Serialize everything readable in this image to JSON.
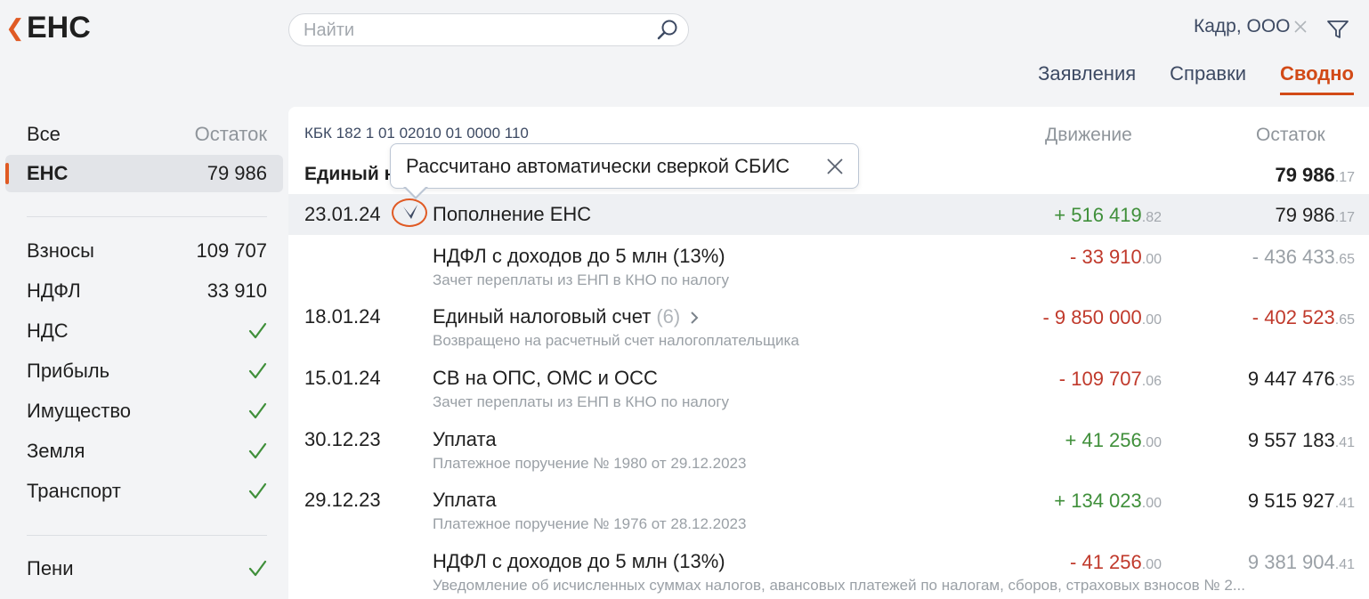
{
  "header": {
    "back_icon": "chevron-left-icon",
    "title": "ЕНС",
    "search": {
      "placeholder": "Найти",
      "value": "",
      "icon": "search-icon"
    },
    "org": "Кадр, ООО",
    "org_clear_icon": "close-icon",
    "filter_icon": "filter-icon"
  },
  "tabs": [
    {
      "label": "Заявления",
      "active": false
    },
    {
      "label": "Справки",
      "active": false
    },
    {
      "label": "Сводно",
      "active": true
    }
  ],
  "sidebar": {
    "all_label": "Все",
    "balance_header": "Остаток",
    "selected": {
      "label": "ЕНС",
      "value": "79 986"
    },
    "taxes": [
      {
        "label": "Взносы",
        "value": "109 707"
      },
      {
        "label": "НДФЛ",
        "value": "33 910"
      },
      {
        "label": "НДС",
        "status": "ok"
      },
      {
        "label": "Прибыль",
        "status": "ok"
      },
      {
        "label": "Имущество",
        "status": "ok"
      },
      {
        "label": "Земля",
        "status": "ok"
      },
      {
        "label": "Транспорт",
        "status": "ok"
      }
    ],
    "penalties": {
      "label": "Пени",
      "status": "ok"
    }
  },
  "main": {
    "kbk": "КБК 182 1 01 02010 01 0000 110",
    "col_movement": "Движение",
    "col_balance": "Остаток",
    "total_label": "Единый налоговый счет",
    "total": {
      "int": "79 986",
      "frac": ".17"
    },
    "rows": [
      {
        "date": "23.01.24",
        "title": "Пополнение ЕНС",
        "subtitle": "",
        "movement": {
          "int": "+ 516 419",
          "frac": ".82",
          "kind": "pos"
        },
        "balance": {
          "int": "79 986",
          "frac": ".17",
          "kind": "normal"
        },
        "highlighted": true,
        "auto_marker": true
      },
      {
        "date": "",
        "title": "НДФЛ с доходов до 5 млн (13%)",
        "subtitle": "Зачет переплаты из ЕНП в КНО по налогу",
        "movement": {
          "int": "- 33 910",
          "frac": ".00",
          "kind": "neg"
        },
        "balance": {
          "int": "- 436 433",
          "frac": ".65",
          "kind": "grey"
        }
      },
      {
        "date": "18.01.24",
        "title": "Единый налоговый счет",
        "count": "(6)",
        "subtitle": "Возвращено на расчетный счет налогоплательщика",
        "movement": {
          "int": "- 9 850 000",
          "frac": ".00",
          "kind": "neg"
        },
        "balance": {
          "int": "- 402 523",
          "frac": ".65",
          "kind": "neg"
        }
      },
      {
        "date": "15.01.24",
        "title": "СВ на ОПС, ОМС и ОСС",
        "subtitle": "Зачет переплаты из ЕНП в КНО по налогу",
        "movement": {
          "int": "- 109 707",
          "frac": ".06",
          "kind": "neg"
        },
        "balance": {
          "int": "9 447 476",
          "frac": ".35",
          "kind": "normal"
        }
      },
      {
        "date": "30.12.23",
        "title": "Уплата",
        "subtitle": "Платежное поручение № 1980 от 29.12.2023",
        "movement": {
          "int": "+ 41 256",
          "frac": ".00",
          "kind": "pos"
        },
        "balance": {
          "int": "9 557 183",
          "frac": ".41",
          "kind": "normal"
        }
      },
      {
        "date": "29.12.23",
        "title": "Уплата",
        "subtitle": "Платежное поручение № 1976 от 28.12.2023",
        "movement": {
          "int": "+ 134 023",
          "frac": ".00",
          "kind": "pos"
        },
        "balance": {
          "int": "9 515 927",
          "frac": ".41",
          "kind": "normal"
        }
      },
      {
        "date": "",
        "title": "НДФЛ с доходов до 5 млн (13%)",
        "subtitle": "Уведомление об исчисленных суммах налогов, авансовых платежей по налогам, сборов, страховых взносов № 2...",
        "movement": {
          "int": "- 41 256",
          "frac": ".00",
          "kind": "neg"
        },
        "balance": {
          "int": "9 381 904",
          "frac": ".41",
          "kind": "grey"
        }
      }
    ]
  },
  "tooltip": {
    "text": "Рассчитано автоматически сверкой СБИС",
    "close_icon": "close-icon"
  },
  "colors": {
    "accent": "#e05a24",
    "positive": "#3f8f3a",
    "negative": "#c0392b",
    "muted": "#9aa0a6"
  }
}
